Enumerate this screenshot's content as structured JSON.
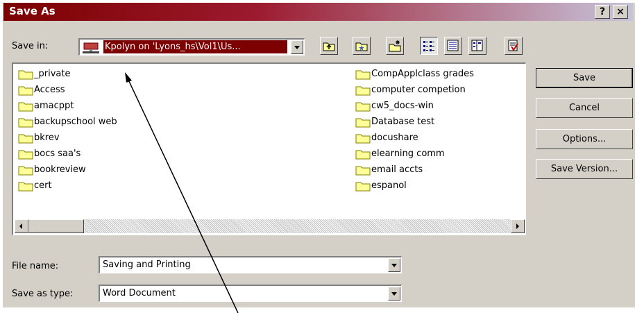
{
  "window": {
    "title": "Save As",
    "help_label": "?",
    "close_label": "×"
  },
  "save_in": {
    "label": "Save in:",
    "value": "Kpolyn on 'Lyons_hs\\Vol1\\Us..."
  },
  "toolbar": {
    "icons": [
      "up-folder-icon",
      "favorites-icon",
      "new-folder-icon",
      "list-view-icon",
      "details-view-icon",
      "properties-view-icon",
      "tools-icon"
    ]
  },
  "files": {
    "left": [
      "_private",
      "Access",
      "amacppt",
      "backupschool web",
      "bkrev",
      "bocs saa's",
      "bookreview",
      "cert"
    ],
    "right": [
      "CompApplclass grades",
      "computer competion",
      "cw5_docs-win",
      "Database test",
      "docushare",
      "elearning comm",
      "email accts",
      "espanol"
    ]
  },
  "buttons": {
    "save": "Save",
    "cancel": "Cancel",
    "options": "Options...",
    "save_version": "Save Version..."
  },
  "file_name": {
    "label": "File name:",
    "value": "Saving and Printing"
  },
  "save_type": {
    "label": "Save as type:",
    "value": "Word Document"
  },
  "colors": {
    "title_start": "#7c0000",
    "selection": "#7c0000",
    "folder": "#ffff99"
  }
}
